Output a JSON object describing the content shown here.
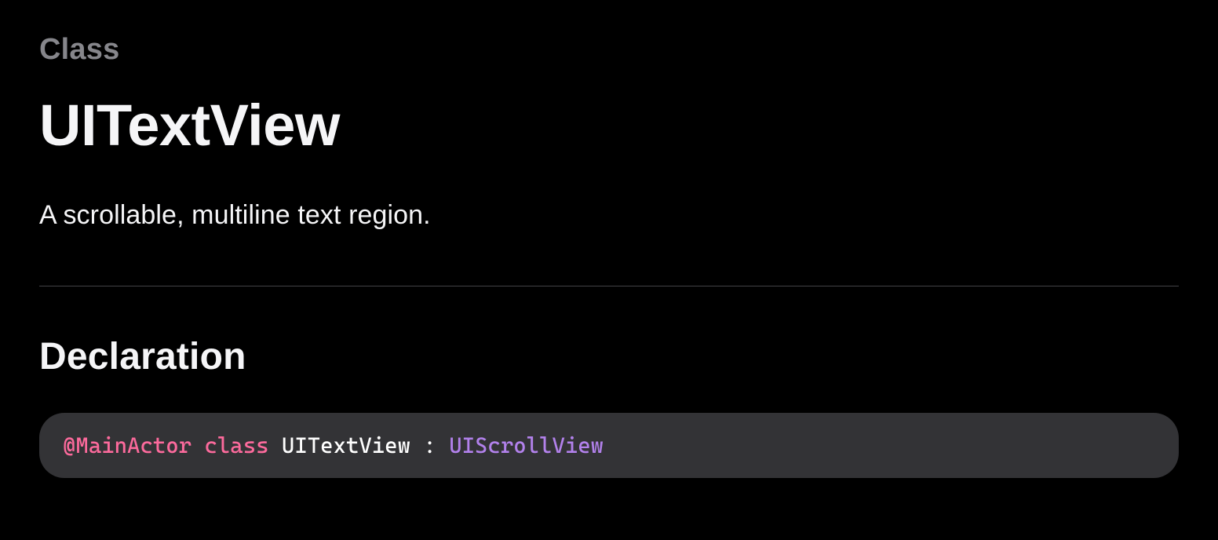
{
  "eyebrow": "Class",
  "title": "UITextView",
  "summary": "A scrollable, multiline text region.",
  "section": {
    "heading": "Declaration"
  },
  "declaration": {
    "attribute": "@MainActor",
    "keyword": "class",
    "identifier": "UITextView",
    "separator": " : ",
    "inherits": "UIScrollView"
  }
}
